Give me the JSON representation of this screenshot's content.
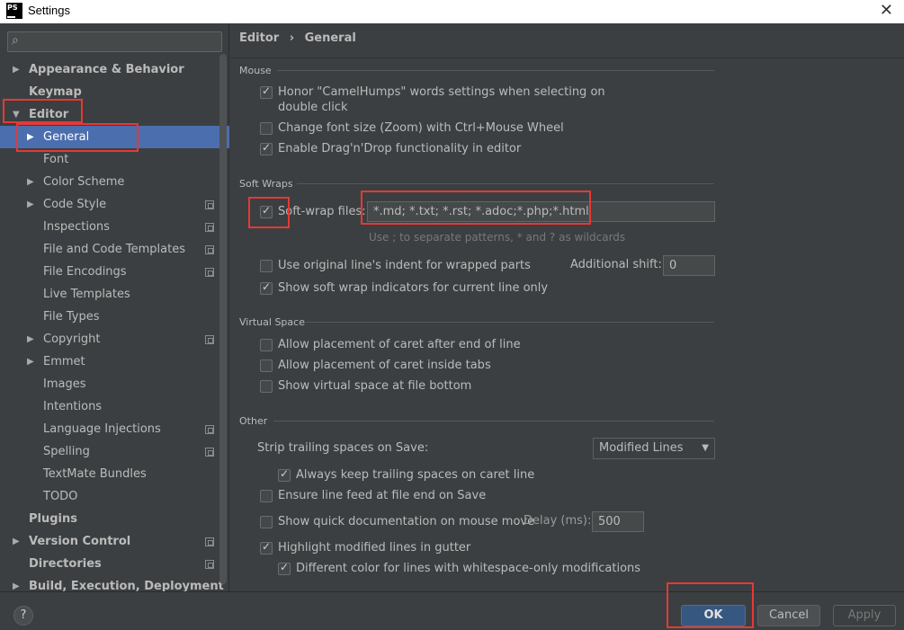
{
  "window": {
    "title": "Settings",
    "app_icon": "phpstorm-icon",
    "close_glyph": "✕",
    "app_icon_text": "PS"
  },
  "search": {
    "placeholder": "",
    "icon": "search-icon"
  },
  "sidebar": {
    "items": [
      {
        "label": "Appearance & Behavior",
        "level": 0,
        "expandable": true,
        "expanded": false,
        "bold": true,
        "project_icon": false
      },
      {
        "label": "Keymap",
        "level": 0,
        "expandable": false,
        "bold": true,
        "project_icon": false
      },
      {
        "label": "Editor",
        "level": 0,
        "expandable": true,
        "expanded": true,
        "bold": true,
        "project_icon": false
      },
      {
        "label": "General",
        "level": 1,
        "expandable": true,
        "expanded": false,
        "selected": true,
        "project_icon": false
      },
      {
        "label": "Font",
        "level": 1,
        "expandable": false,
        "project_icon": false
      },
      {
        "label": "Color Scheme",
        "level": 1,
        "expandable": true,
        "project_icon": false
      },
      {
        "label": "Code Style",
        "level": 1,
        "expandable": true,
        "project_icon": true
      },
      {
        "label": "Inspections",
        "level": 1,
        "expandable": false,
        "project_icon": true
      },
      {
        "label": "File and Code Templates",
        "level": 1,
        "expandable": false,
        "project_icon": true
      },
      {
        "label": "File Encodings",
        "level": 1,
        "expandable": false,
        "project_icon": true
      },
      {
        "label": "Live Templates",
        "level": 1,
        "expandable": false,
        "project_icon": false
      },
      {
        "label": "File Types",
        "level": 1,
        "expandable": false,
        "project_icon": false
      },
      {
        "label": "Copyright",
        "level": 1,
        "expandable": true,
        "project_icon": true
      },
      {
        "label": "Emmet",
        "level": 1,
        "expandable": true,
        "project_icon": false
      },
      {
        "label": "Images",
        "level": 1,
        "expandable": false,
        "project_icon": false
      },
      {
        "label": "Intentions",
        "level": 1,
        "expandable": false,
        "project_icon": false
      },
      {
        "label": "Language Injections",
        "level": 1,
        "expandable": false,
        "project_icon": true
      },
      {
        "label": "Spelling",
        "level": 1,
        "expandable": false,
        "project_icon": true
      },
      {
        "label": "TextMate Bundles",
        "level": 1,
        "expandable": false,
        "project_icon": false
      },
      {
        "label": "TODO",
        "level": 1,
        "expandable": false,
        "project_icon": false
      },
      {
        "label": "Plugins",
        "level": 0,
        "expandable": false,
        "bold": true,
        "project_icon": false
      },
      {
        "label": "Version Control",
        "level": 0,
        "expandable": true,
        "bold": true,
        "project_icon": true
      },
      {
        "label": "Directories",
        "level": 0,
        "expandable": false,
        "bold": true,
        "project_icon": true
      },
      {
        "label": "Build, Execution, Deployment",
        "level": 0,
        "expandable": true,
        "bold": true,
        "project_icon": false
      }
    ]
  },
  "breadcrumb": {
    "parent": "Editor",
    "separator": "›",
    "current": "General"
  },
  "mouse": {
    "title": "Mouse",
    "camelhumps_line1": "Honor \"CamelHumps\" words settings when selecting on",
    "camelhumps_line2": "double click",
    "camelhumps_checked": true,
    "zoom": "Change font size (Zoom) with Ctrl+Mouse Wheel",
    "zoom_checked": false,
    "dragdrop": "Enable Drag'n'Drop functionality in editor",
    "dragdrop_checked": true
  },
  "soft_wraps": {
    "title": "Soft Wraps",
    "files_label": "Soft-wrap files:",
    "files_checked": true,
    "files_value": "*.md; *.txt; *.rst; *.adoc;*.php;*.html",
    "hint": "Use ; to separate patterns, * and ? as wildcards",
    "indent": "Use original line's indent for wrapped parts",
    "indent_checked": false,
    "shift_label": "Additional shift:",
    "shift_value": "0",
    "indicators": "Show soft wrap indicators for current line only",
    "indicators_checked": true
  },
  "virtual_space": {
    "title": "Virtual Space",
    "after_eol": "Allow placement of caret after end of line",
    "after_eol_checked": false,
    "inside_tabs": "Allow placement of caret inside tabs",
    "inside_tabs_checked": false,
    "at_bottom": "Show virtual space at file bottom",
    "at_bottom_checked": false
  },
  "other": {
    "title": "Other",
    "strip_label": "Strip trailing spaces on Save:",
    "strip_value": "Modified Lines",
    "keep_trailing": "Always keep trailing spaces on caret line",
    "keep_trailing_checked": true,
    "line_feed": "Ensure line feed at file end on Save",
    "line_feed_checked": false,
    "quick_doc": "Show quick documentation on mouse move",
    "quick_doc_checked": false,
    "delay_label": "Delay (ms):",
    "delay_value": "500",
    "highlight": "Highlight modified lines in gutter",
    "highlight_checked": true,
    "whitespace": "Different color for lines with whitespace-only modifications",
    "whitespace_checked": true
  },
  "footer": {
    "help": "?",
    "ok": "OK",
    "cancel": "Cancel",
    "apply": "Apply"
  },
  "colors": {
    "accent": "#4b6eaf",
    "ok_button": "#365880",
    "highlight_box": "#e53935",
    "background": "#3c3f41"
  }
}
